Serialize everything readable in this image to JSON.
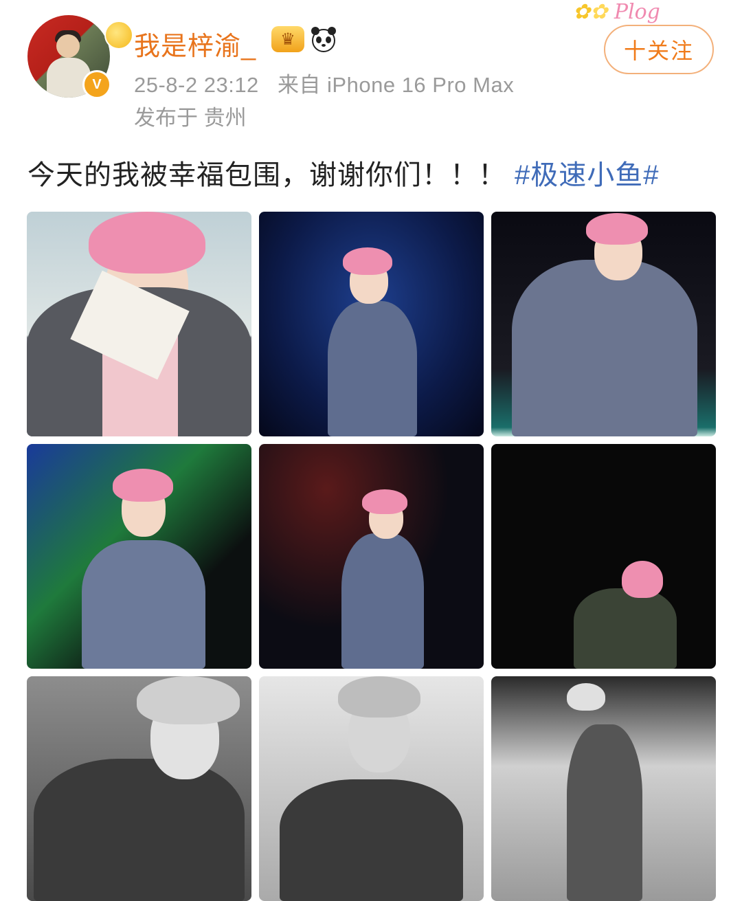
{
  "author": {
    "name": "我是梓渝_",
    "verified_badge": "V",
    "vip_icon": "crown-icon",
    "extra_icon": "panda-icon"
  },
  "meta": {
    "date": "25-8-2 23:12",
    "source": "来自 iPhone 16 Pro Max",
    "location": "发布于 贵州"
  },
  "follow": {
    "label": "十关注"
  },
  "decoration_text": "Plog",
  "post": {
    "text": "今天的我被幸福包围，谢谢你们！！！",
    "hashtag": "#极速小鱼#"
  },
  "photos": [
    {
      "name": "photo-1",
      "tone": "color"
    },
    {
      "name": "photo-2",
      "tone": "color"
    },
    {
      "name": "photo-3",
      "tone": "color"
    },
    {
      "name": "photo-4",
      "tone": "color"
    },
    {
      "name": "photo-5",
      "tone": "color"
    },
    {
      "name": "photo-6",
      "tone": "color"
    },
    {
      "name": "photo-7",
      "tone": "monochrome"
    },
    {
      "name": "photo-8",
      "tone": "monochrome"
    },
    {
      "name": "photo-9",
      "tone": "monochrome"
    }
  ],
  "colors": {
    "username": "#e8741c",
    "hashtag": "#3f6bb8",
    "meta": "#9a9a9a",
    "follow_border": "#f3b07a"
  }
}
